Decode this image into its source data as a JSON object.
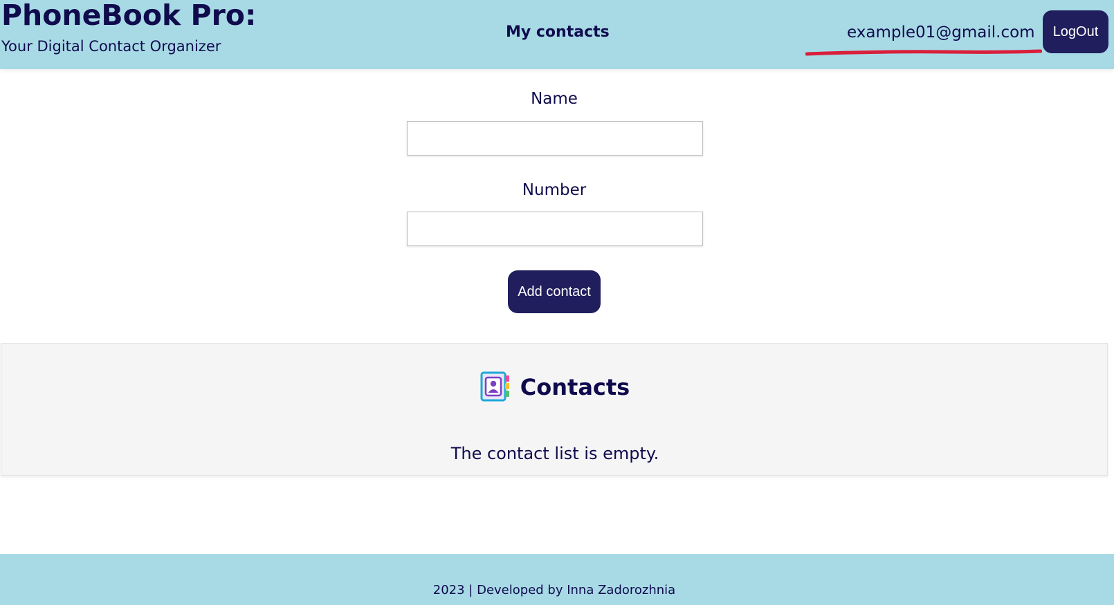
{
  "header": {
    "brand_title": "PhoneBook Pro:",
    "brand_subtitle": "Your Digital Contact Organizer",
    "nav_link": "My contacts",
    "user_email": "example01@gmail.com",
    "logout_label": "LogOut"
  },
  "form": {
    "name_label": "Name",
    "name_value": "",
    "number_label": "Number",
    "number_value": "",
    "submit_label": "Add contact"
  },
  "contacts": {
    "heading": "Contacts",
    "heading_icon": "address-book-icon",
    "empty_message": "The contact list is empty."
  },
  "footer": {
    "text": "2023 | Developed by Inna Zadorozhnia"
  },
  "colors": {
    "header_bg": "#a8dae6",
    "text_primary": "#0f0b4d",
    "button_bg": "#201e5c",
    "annotation_underline": "#d91f3a",
    "panel_bg": "#f5f5f5"
  }
}
